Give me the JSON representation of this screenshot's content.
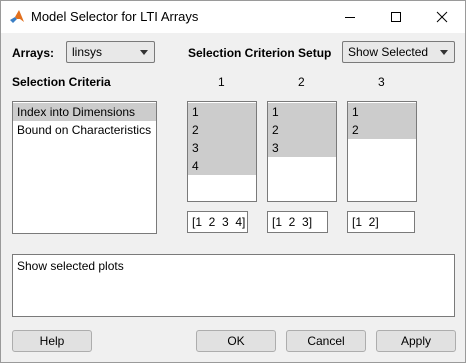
{
  "window": {
    "title": "Model Selector for LTI Arrays"
  },
  "arrays": {
    "label": "Arrays:",
    "selected": "linsys"
  },
  "setup": {
    "label": "Selection Criterion Setup",
    "selected": "Show Selected"
  },
  "criteria": {
    "header": "Selection Criteria",
    "items": [
      {
        "label": "Index into Dimensions",
        "selected": true
      },
      {
        "label": "Bound on Characteristics",
        "selected": false
      }
    ]
  },
  "dimensions": [
    {
      "header": "1",
      "items": [
        "1",
        "2",
        "3",
        "4"
      ],
      "selected_count": 4,
      "expression": "[1  2  3  4]"
    },
    {
      "header": "2",
      "items": [
        "1",
        "2",
        "3"
      ],
      "selected_count": 3,
      "expression": "[1  2  3]"
    },
    {
      "header": "3",
      "items": [
        "1",
        "2"
      ],
      "selected_count": 2,
      "expression": "[1  2]"
    }
  ],
  "status": {
    "text": "Show selected plots"
  },
  "buttons": {
    "help": "Help",
    "ok": "OK",
    "cancel": "Cancel",
    "apply": "Apply"
  },
  "colors": {
    "selection": "#cccccc",
    "window_bg": "#f0f0f0"
  }
}
